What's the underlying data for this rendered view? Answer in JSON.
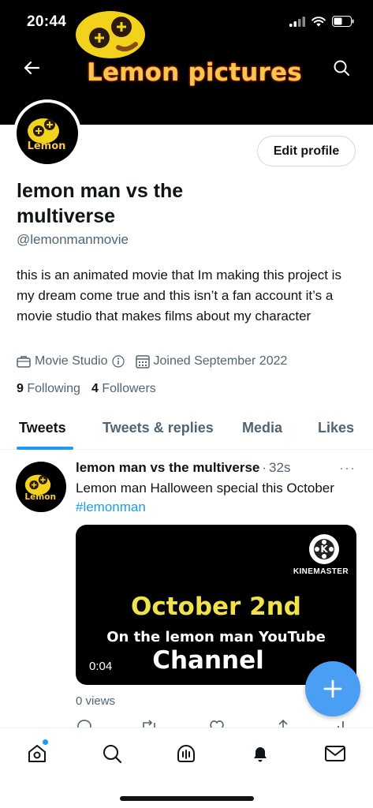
{
  "status_bar": {
    "time": "20:44"
  },
  "banner": {
    "title": "Lemon pictures"
  },
  "avatar": {
    "logo_text": "Lemon"
  },
  "profile": {
    "edit_label": "Edit profile",
    "name": "lemon man vs the multiverse",
    "handle": "@lemonmanmovie",
    "bio": "this is an animated movie that Im making this project is my dream come true and this isn’t a fan account it’s a movie studio that makes films about my character",
    "category": "Movie Studio",
    "joined": "Joined September 2022",
    "following_count": "9",
    "following_label": "Following",
    "followers_count": "4",
    "followers_label": "Followers"
  },
  "tabs": [
    "Tweets",
    "Tweets & replies",
    "Media",
    "Likes"
  ],
  "tweet": {
    "name": "lemon man vs the multiverse",
    "separator": "·",
    "time": "32s",
    "text": "Lemon man Halloween special this October ",
    "hashtag": "#lemonman",
    "more": "···",
    "media": {
      "watermark": "KINEMASTER",
      "line1": "October 2nd",
      "line2": "On the lemon man YouTube",
      "line3": "Channel",
      "duration": "0:04"
    },
    "views": "0 views"
  },
  "icons": {
    "back": "arrow-left-icon",
    "search": "search-icon",
    "compose": "plus-icon",
    "nav": [
      "home-icon",
      "explore-icon",
      "spaces-icon",
      "notifications-icon",
      "messages-icon"
    ]
  },
  "colors": {
    "accent": "#1d9bf0",
    "fab": "#4a9ff5",
    "banner_text": "#f6c84a",
    "media_text": "#f1e24a"
  }
}
